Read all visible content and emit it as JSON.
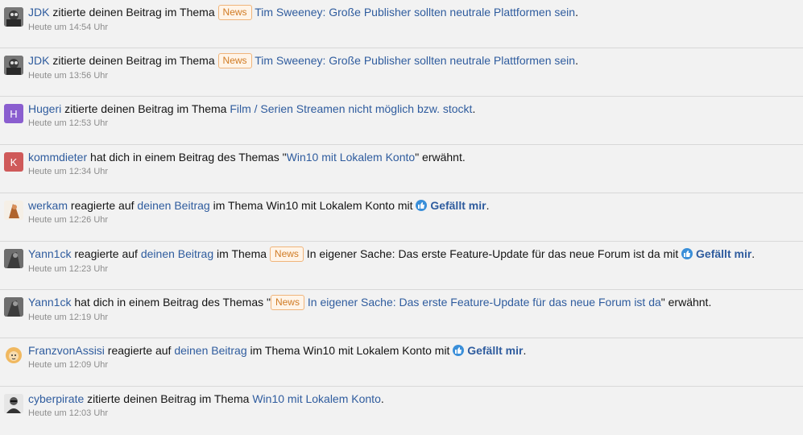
{
  "colors": {
    "link": "#2f5c9e",
    "badge_border": "#f0b47a",
    "badge_text": "#d07b24",
    "like": "#3a8fd9"
  },
  "notifications": [
    {
      "user": "JDK",
      "action": " zitierte deinen Beitrag im Thema ",
      "badge": "News",
      "thread": "Tim Sweeney: Große Publisher sollten neutrale Plattformen sein",
      "end": ".",
      "time": "Heute um 14:54 Uhr",
      "avatar_icon": "photo-avatar-icon"
    },
    {
      "user": "JDK",
      "action": " zitierte deinen Beitrag im Thema ",
      "badge": "News",
      "thread": "Tim Sweeney: Große Publisher sollten neutrale Plattformen sein",
      "end": ".",
      "time": "Heute um 13:56 Uhr",
      "avatar_icon": "photo-avatar-icon"
    },
    {
      "user": "Hugeri",
      "action": " zitierte deinen Beitrag im Thema ",
      "thread": "Film / Serien Streamen nicht möglich bzw. stockt",
      "end": ".",
      "time": "Heute um 12:53 Uhr",
      "avatar_letter": "H",
      "avatar_color": "#8a5ecf"
    },
    {
      "user": "kommdieter",
      "action": " hat dich in einem Beitrag des Themas \"",
      "thread": "Win10 mit Lokalem Konto",
      "end": "\" erwähnt.",
      "time": "Heute um 12:34 Uhr",
      "avatar_letter": "K",
      "avatar_color": "#cf5a5a"
    },
    {
      "user": "werkam",
      "action": " reagierte auf ",
      "post_link": "deinen Beitrag",
      "mid": " im Thema Win10 mit Lokalem Konto mit ",
      "like": "Gefällt mir",
      "end": ".",
      "time": "Heute um 12:26 Uhr",
      "avatar_icon": "photo-avatar-icon"
    },
    {
      "user": "Yann1ck",
      "action": " reagierte auf ",
      "post_link": "deinen Beitrag",
      "mid": " im Thema ",
      "badge": "News",
      "mid2": " In eigener Sache: Das erste Feature-Update für das neue Forum ist da mit ",
      "like": "Gefällt mir",
      "end": ".",
      "time": "Heute um 12:23 Uhr",
      "avatar_icon": "photo-avatar-icon"
    },
    {
      "user": "Yann1ck",
      "action": " hat dich in einem Beitrag des Themas \"",
      "badge": "News",
      "thread": "In eigener Sache: Das erste Feature-Update für das neue Forum ist da",
      "end": "\" erwähnt.",
      "time": "Heute um 12:19 Uhr",
      "avatar_icon": "photo-avatar-icon"
    },
    {
      "user": "FranzvonAssisi",
      "action": " reagierte auf ",
      "post_link": "deinen Beitrag",
      "mid": " im Thema Win10 mit Lokalem Konto mit ",
      "like": "Gefällt mir",
      "end": ".",
      "time": "Heute um 12:09 Uhr",
      "avatar_icon": "photo-avatar-icon"
    },
    {
      "user": "cyberpirate",
      "action": " zitierte deinen Beitrag im Thema ",
      "thread": "Win10 mit Lokalem Konto",
      "end": ".",
      "time": "Heute um 12:03 Uhr",
      "avatar_icon": "photo-avatar-icon"
    }
  ]
}
